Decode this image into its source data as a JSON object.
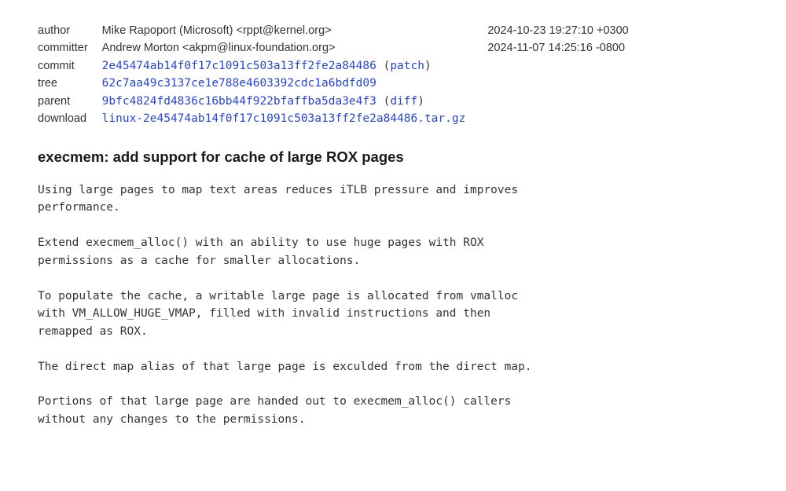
{
  "commit_info": {
    "author_label": "author",
    "author_value": "Mike Rapoport (Microsoft) <rppt@kernel.org>",
    "author_date": "2024-10-23 19:27:10 +0300",
    "committer_label": "committer",
    "committer_value": "Andrew Morton <akpm@linux-foundation.org>",
    "committer_date": "2024-11-07 14:25:16 -0800",
    "commit_label": "commit",
    "commit_hash": "2e45474ab14f0f17c1091c503a13ff2fe2a84486",
    "commit_patch_label": "patch",
    "tree_label": "tree",
    "tree_hash": "62c7aa49c3137ce1e788e4603392cdc1a6bdfd09",
    "parent_label": "parent",
    "parent_hash": "9bfc4824fd4836c16bb44f922bfaffba5da3e4f3",
    "parent_diff_label": "diff",
    "download_label": "download",
    "download_file": "linux-2e45474ab14f0f17c1091c503a13ff2fe2a84486.tar.gz"
  },
  "commit_subject": "execmem: add support for cache of large ROX pages",
  "commit_msg": "Using large pages to map text areas reduces iTLB pressure and improves\nperformance.\n\nExtend execmem_alloc() with an ability to use huge pages with ROX\npermissions as a cache for smaller allocations.\n\nTo populate the cache, a writable large page is allocated from vmalloc\nwith VM_ALLOW_HUGE_VMAP, filled with invalid instructions and then\nremapped as ROX.\n\nThe direct map alias of that large page is exculded from the direct map.\n\nPortions of that large page are handed out to execmem_alloc() callers\nwithout any changes to the permissions."
}
